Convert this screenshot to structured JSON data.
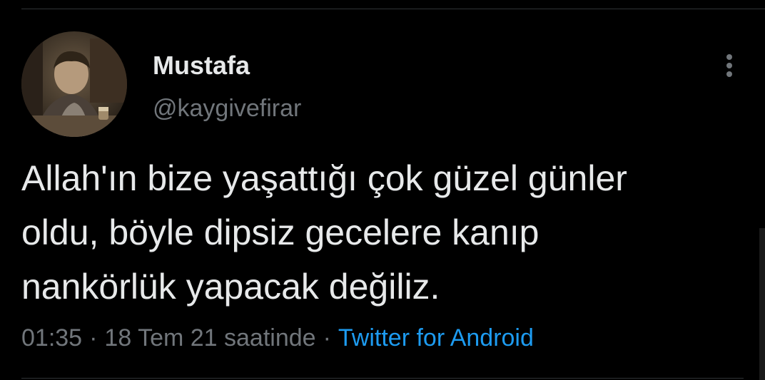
{
  "tweet": {
    "author": {
      "display_name": "Mustafa",
      "handle": "@kaygivefirar"
    },
    "text": "Allah'ın bize yaşattığı çok güzel günler\noldu, böyle dipsiz gecelere kanıp\nnankörlük yapacak değiliz.",
    "time": "01:35",
    "date": "18 Tem 21 saatinde",
    "separator": "·",
    "source": "Twitter for Android"
  },
  "icons": {
    "more": "more-vertical-icon"
  },
  "colors": {
    "background": "#000000",
    "primary_text": "#e7e9ea",
    "secondary_text": "#71767b",
    "link": "#1d9bf0",
    "divider": "#2f3336"
  }
}
